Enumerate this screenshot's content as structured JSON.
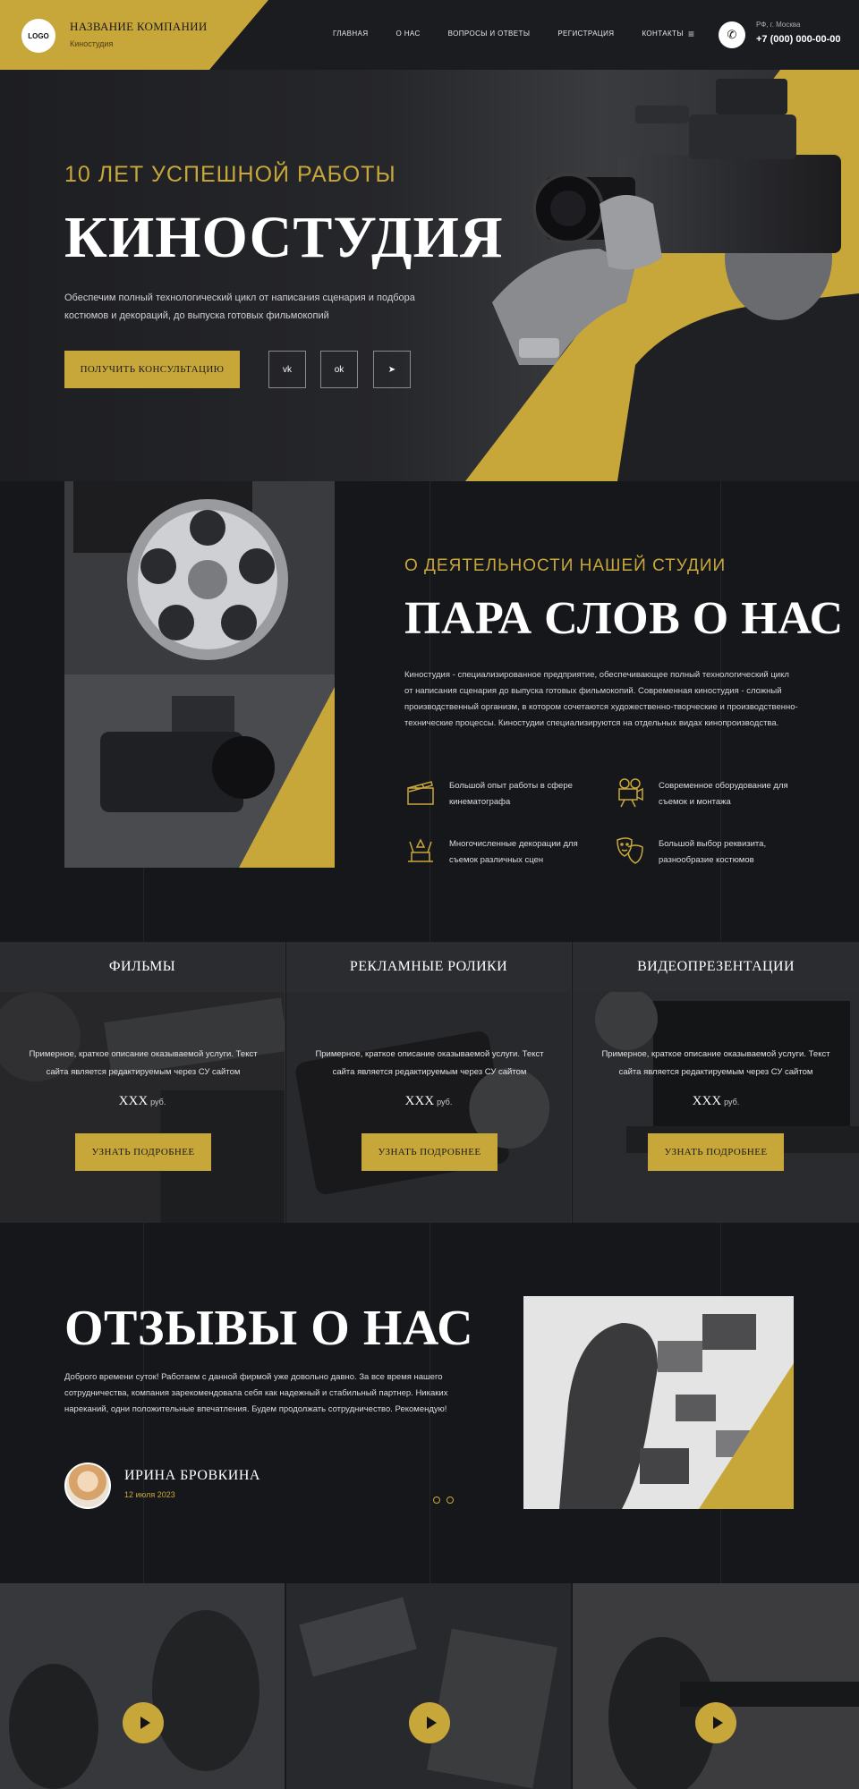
{
  "header": {
    "logo": "LOGO",
    "company_name": "НАЗВАНИЕ КОМПАНИИ",
    "company_sub": "Киностудия",
    "nav": [
      "ГЛАВНАЯ",
      "О НАС",
      "ВОПРОСЫ И ОТВЕТЫ",
      "РЕГИСТРАЦИЯ",
      "КОНТАКТЫ"
    ],
    "menu_icon": "≡",
    "phone_icon": "✆",
    "city": "РФ, г. Москва",
    "phone": "+7 (000) 000-00-00"
  },
  "hero": {
    "overline": "10 ЛЕТ УСПЕШНОЙ РАБОТЫ",
    "title": "КИНОСТУДИЯ",
    "text": "Обеспечим полный технологический цикл от написания сценария и подбора костюмов и декораций, до выпуска готовых фильмокопий",
    "button": "ПОЛУЧИТЬ КОНСУЛЬТАЦИЮ",
    "socials": [
      "vk",
      "ok",
      "➤"
    ]
  },
  "about": {
    "overline": "О ДЕЯТЕЛЬНОСТИ НАШЕЙ СТУДИИ",
    "title": "ПАРА СЛОВ О НАС",
    "text": "Киностудия - специализированное предприятие, обеспечивающее полный технологический цикл от написания сценария до выпуска готовых фильмокопий. Современная киностудия - сложный производственный организм, в котором сочетаются художественно-творческие и производственно-технические процессы. Киностудии специализируются на отдельных видах кинопроизводства.",
    "features": [
      {
        "icon": "clapperboard-icon",
        "text": "Большой опыт работы в сфере кинематографа"
      },
      {
        "icon": "movie-camera-icon",
        "text": "Современное оборудование для съемок и монтажа"
      },
      {
        "icon": "stage-decoration-icon",
        "text": "Многочисленные декорации для съемок различных сцен"
      },
      {
        "icon": "theater-masks-icon",
        "text": "Большой выбор реквизита, разнообразие костюмов"
      }
    ]
  },
  "services": [
    {
      "title": "ФИЛЬМЫ",
      "desc": "Примерное, краткое описание оказываемой услуги. Текст сайта является редактируемым через СУ сайтом",
      "price": "XXX",
      "unit": "руб.",
      "button": "УЗНАТЬ ПОДРОБНЕЕ"
    },
    {
      "title": "РЕКЛАМНЫЕ РОЛИКИ",
      "desc": "Примерное, краткое описание оказываемой услуги. Текст сайта является редактируемым через СУ сайтом",
      "price": "XXX",
      "unit": "руб.",
      "button": "УЗНАТЬ ПОДРОБНЕЕ"
    },
    {
      "title": "ВИДЕОПРЕЗЕНТАЦИИ",
      "desc": "Примерное, краткое описание оказываемой услуги. Текст сайта является редактируемым через СУ сайтом",
      "price": "XXX",
      "unit": "руб.",
      "button": "УЗНАТЬ ПОДРОБНЕЕ"
    }
  ],
  "reviews": {
    "title": "ОТЗЫВЫ О НАС",
    "text": "Доброго времени суток! Работаем с данной фирмой уже довольно давно. За все время нашего сотрудничества, компания зарекомендовала себя как надежный и стабильный партнер. Никаких нареканий, одни положительные впечатления. Будем продолжать сотрудничество. Рекомендую!",
    "name": "ИРИНА БРОВКИНА",
    "date": "12 июля 2023"
  },
  "colors": {
    "accent": "#c8a73a",
    "background": "#16171b",
    "panel": "#242529"
  }
}
